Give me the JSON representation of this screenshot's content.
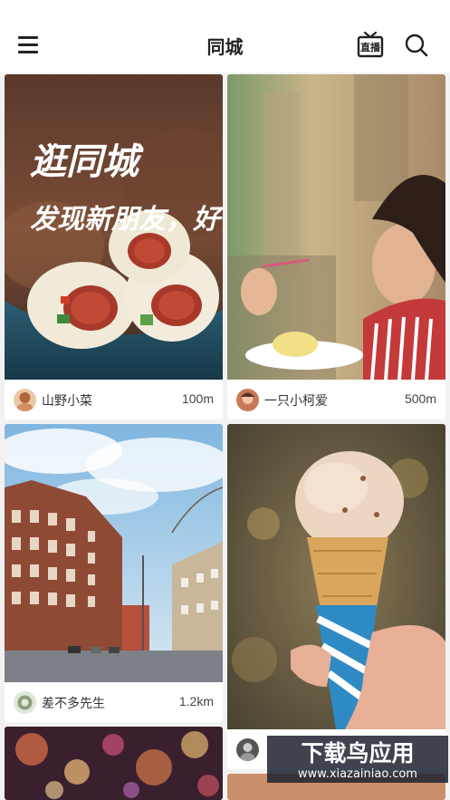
{
  "header": {
    "title": "同城",
    "live_label": "直播"
  },
  "feed": [
    {
      "overlay_line1": "逛同城",
      "overlay_line2": "发现新朋友，好去处",
      "user": "山野小菜",
      "distance": "100m"
    },
    {
      "user": "一只小柯爱",
      "distance": "500m"
    },
    {
      "user": "差不多先生",
      "distance": "1.2km"
    },
    {
      "user": "",
      "distance": ""
    }
  ],
  "watermark": {
    "line1": "下载鸟应用",
    "line2": "www.xiazainiao.com"
  }
}
